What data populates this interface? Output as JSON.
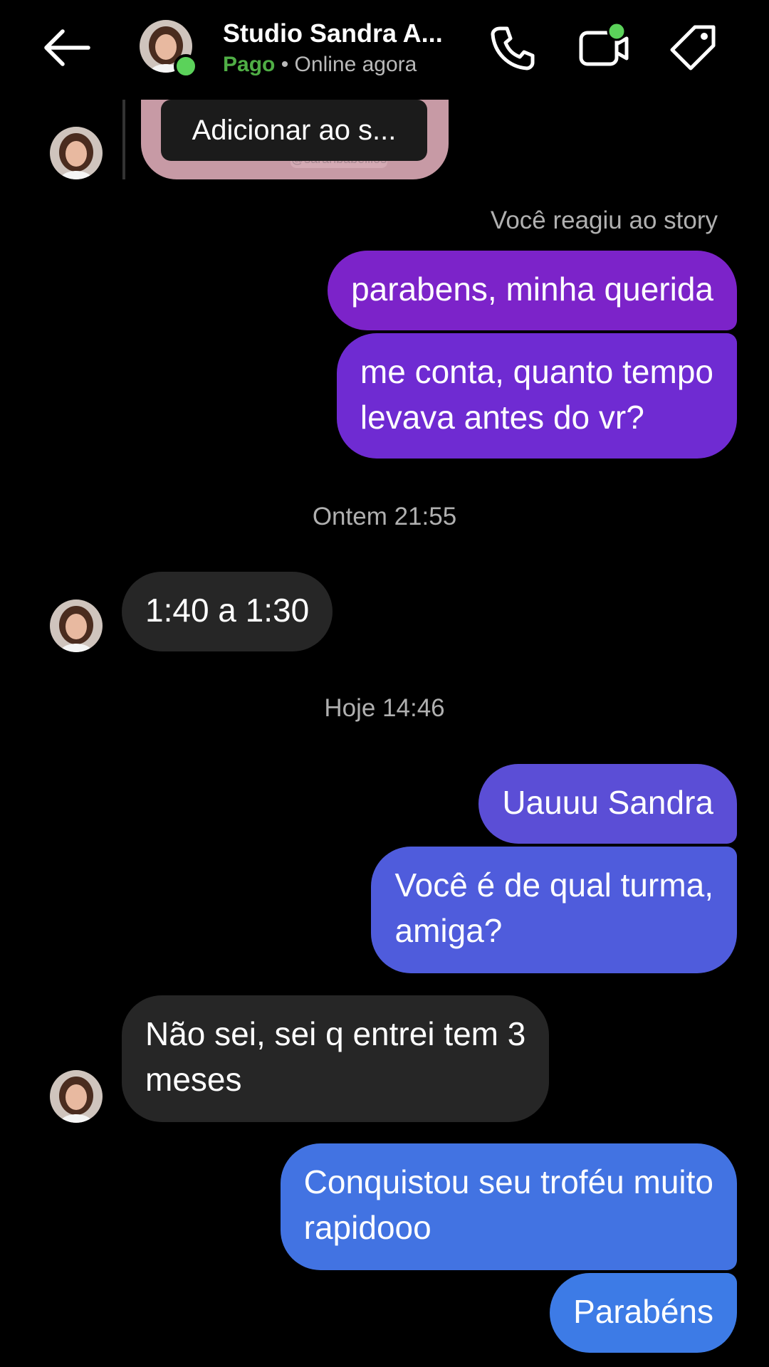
{
  "header": {
    "contact_name": "Studio Sandra A...",
    "paid_label": "Pago",
    "separator": " • ",
    "status_text": "Online agora",
    "icons": {
      "back": "back-arrow-icon",
      "call": "phone-icon",
      "video": "video-camera-icon",
      "tag": "tag-icon"
    }
  },
  "story": {
    "button_label": "Adicionar ao s...",
    "watermark": "@sarahbabeillos"
  },
  "thread": {
    "reaction_note": "Você reagiu ao story",
    "timestamp_1": "Ontem 21:55",
    "timestamp_2": "Hoje 14:46",
    "messages": [
      {
        "side": "out",
        "lines": [
          "parabens, minha querida"
        ]
      },
      {
        "side": "out",
        "lines": [
          "me conta, quanto tempo",
          "levava antes do vr?"
        ]
      },
      {
        "side": "in",
        "lines": [
          "1:40 a 1:30"
        ]
      },
      {
        "side": "out",
        "lines": [
          "Uauuu Sandra"
        ]
      },
      {
        "side": "out",
        "lines": [
          "Você é de qual turma,",
          "amiga?"
        ]
      },
      {
        "side": "in",
        "lines": [
          "Não sei, sei q entrei tem 3",
          "meses"
        ]
      },
      {
        "side": "out",
        "lines": [
          "Conquistou seu troféu muito",
          "rapidooo"
        ]
      },
      {
        "side": "out",
        "lines": [
          "Parabéns"
        ]
      }
    ]
  },
  "colors": {
    "background": "#000000",
    "online_dot": "#5bd25a",
    "paid_green": "#4fae45",
    "incoming_bubble": "#262626",
    "outgoing_gradient_top": "#7c23c9",
    "outgoing_gradient_bottom": "#3d7be6"
  }
}
